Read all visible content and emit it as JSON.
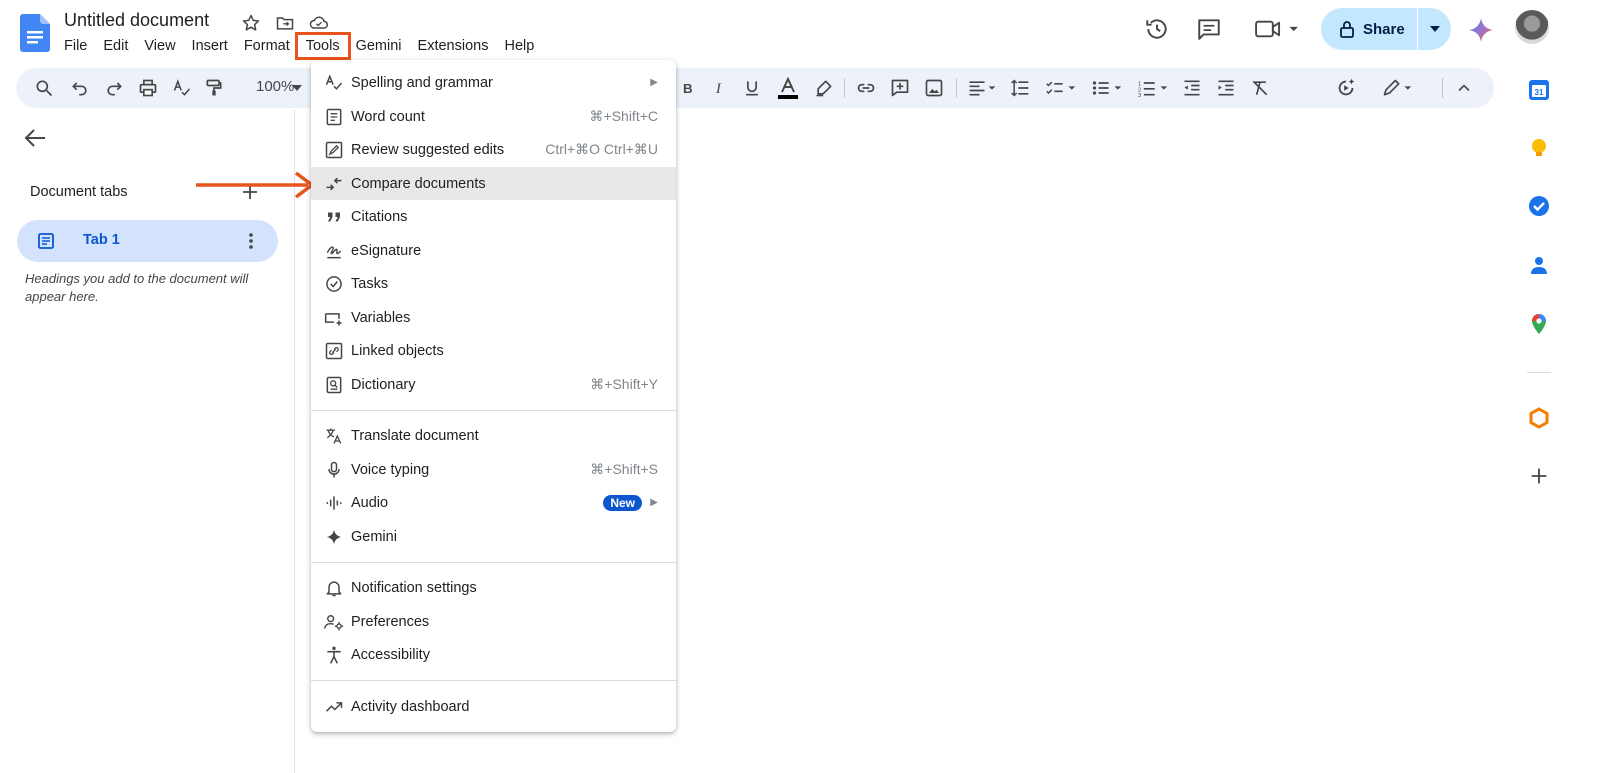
{
  "doc": {
    "title": "Untitled document"
  },
  "menu": [
    "File",
    "Edit",
    "View",
    "Insert",
    "Format",
    "Tools",
    "Gemini",
    "Extensions",
    "Help"
  ],
  "share": {
    "label": "Share"
  },
  "toolbar": {
    "zoom": "100%"
  },
  "left_panel": {
    "heading": "Document tabs",
    "tab_label": "Tab 1",
    "hint": "Headings you add to the document will appear here."
  },
  "tools_menu": {
    "items": [
      {
        "label": "Spelling and grammar",
        "shortcut": "",
        "submenu": true,
        "icon": "spellcheck-icon"
      },
      {
        "label": "Word count",
        "shortcut": "⌘+Shift+C",
        "submenu": false,
        "icon": "word-count-icon"
      },
      {
        "label": "Review suggested edits",
        "shortcut": "Ctrl+⌘O Ctrl+⌘U",
        "submenu": false,
        "icon": "review-edits-icon"
      },
      {
        "label": "Compare documents",
        "shortcut": "",
        "submenu": false,
        "icon": "compare-icon"
      },
      {
        "label": "Citations",
        "shortcut": "",
        "submenu": false,
        "icon": "quote-icon"
      },
      {
        "label": "eSignature",
        "shortcut": "",
        "submenu": false,
        "icon": "signature-icon"
      },
      {
        "label": "Tasks",
        "shortcut": "",
        "submenu": false,
        "icon": "task-icon"
      },
      {
        "label": "Variables",
        "shortcut": "",
        "submenu": false,
        "icon": "variables-icon"
      },
      {
        "label": "Linked objects",
        "shortcut": "",
        "submenu": false,
        "icon": "linked-objects-icon"
      },
      {
        "label": "Dictionary",
        "shortcut": "⌘+Shift+Y",
        "submenu": false,
        "icon": "dictionary-icon"
      },
      {
        "label": "Translate document",
        "shortcut": "",
        "submenu": false,
        "icon": "translate-icon"
      },
      {
        "label": "Voice typing",
        "shortcut": "⌘+Shift+S",
        "submenu": false,
        "icon": "microphone-icon"
      },
      {
        "label": "Audio",
        "shortcut": "",
        "submenu": true,
        "badge": "New",
        "icon": "audio-icon"
      },
      {
        "label": "Gemini",
        "shortcut": "",
        "submenu": false,
        "icon": "sparkle-icon"
      },
      {
        "label": "Notification settings",
        "shortcut": "",
        "submenu": false,
        "icon": "bell-icon"
      },
      {
        "label": "Preferences",
        "shortcut": "",
        "submenu": false,
        "icon": "preferences-icon"
      },
      {
        "label": "Accessibility",
        "shortcut": "",
        "submenu": false,
        "icon": "accessibility-icon"
      },
      {
        "label": "Activity dashboard",
        "shortcut": "",
        "submenu": false,
        "icon": "trending-icon"
      }
    ],
    "highlighted": "Compare documents"
  },
  "colors": {
    "accent_blue": "#0b57d0",
    "share_bg": "#c2e7ff",
    "annotation": "#e8541b",
    "tab_bg": "#d3e3fd",
    "toolbar_bg": "#edf2fa"
  },
  "side_panel": [
    "calendar-icon",
    "keep-icon",
    "tasks-icon",
    "contacts-icon",
    "maps-icon",
    "zoho-icon",
    "add-icon"
  ]
}
